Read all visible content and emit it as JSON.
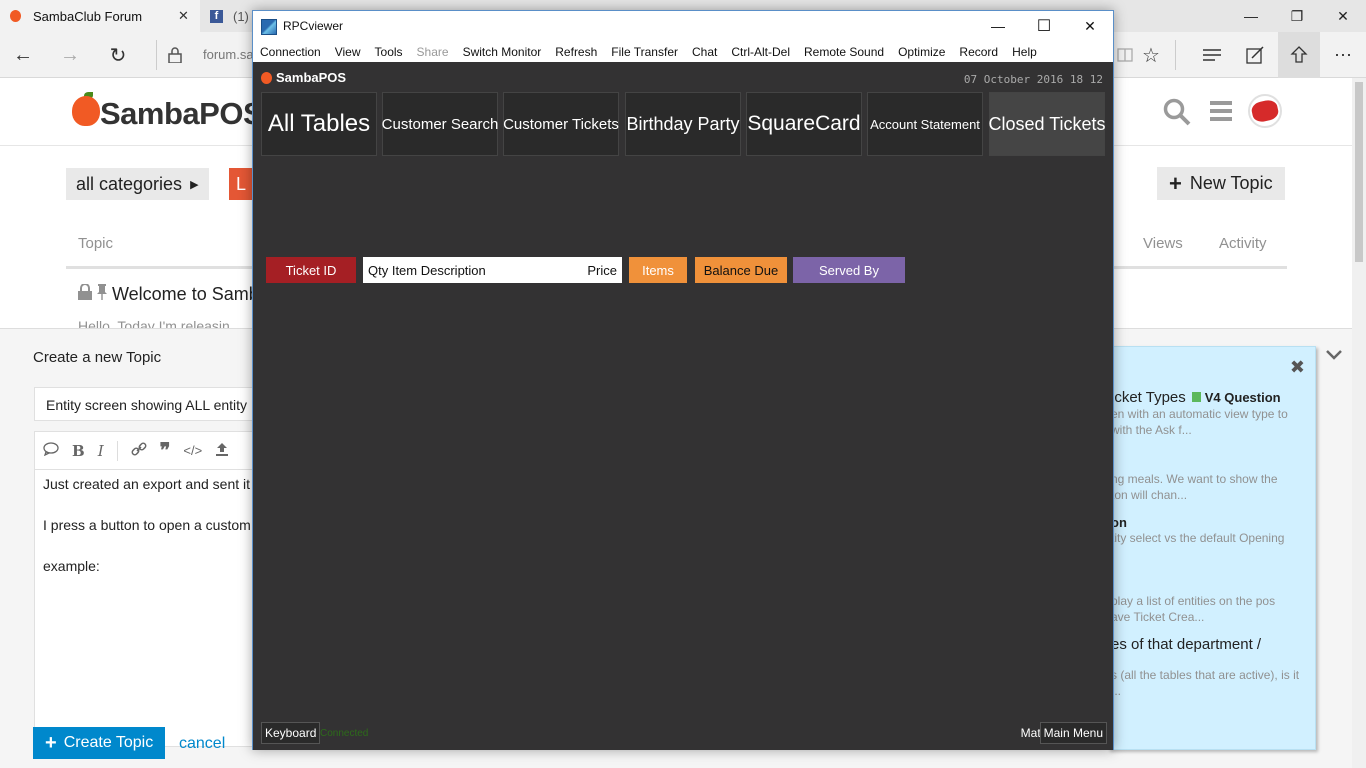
{
  "browser": {
    "tabs": [
      {
        "title": "SambaClub Forum",
        "close": "✕"
      },
      {
        "title": "(1)"
      }
    ],
    "address": "forum.sa",
    "window_controls": {
      "minimize": "—",
      "restore": "❐",
      "close": "✕"
    }
  },
  "forum": {
    "logo": "SambaPOS",
    "category_button": "all categories",
    "latest_button": "L",
    "new_topic_button": "New Topic",
    "columns": {
      "topic": "Topic",
      "views": "Views",
      "activity": "Activity"
    },
    "pinned_topic": {
      "title": "Welcome to Samb",
      "excerpt": "Hello. Today I'm releasin"
    },
    "composer": {
      "heading": "Create a new Topic",
      "title_value": "Entity screen showing ALL entity",
      "body_lines": [
        "Just created an export and sent it",
        "I press a button to open a custom",
        "example:"
      ],
      "create_button": "Create Topic",
      "cancel_link": "cancel"
    },
    "similar_topics": [
      {
        "title": "icket Types",
        "category": "V4 Question",
        "excerpt": [
          "en with an automatic view type to",
          "with the Ask f..."
        ]
      },
      {
        "title": "",
        "excerpt": [
          "ng meals. We want to show the",
          "ton will chan..."
        ]
      },
      {
        "title": "on",
        "excerpt": [
          "tity select vs the default Opening"
        ]
      },
      {
        "title": "",
        "excerpt": [
          "play a list of entities on the pos",
          "ave Ticket Crea..."
        ]
      },
      {
        "title": "es of that department /",
        "excerpt": [
          "s (all the tables that are active), is it",
          "..."
        ]
      }
    ]
  },
  "rpc": {
    "title": "RPCviewer",
    "menu": [
      "Connection",
      "View",
      "Tools",
      "Share",
      "Switch Monitor",
      "Refresh",
      "File Transfer",
      "Chat",
      "Ctrl-Alt-Del",
      "Remote Sound",
      "Optimize",
      "Record",
      "Help"
    ],
    "disabled_menu": "Share",
    "controls": {
      "minimize": "—",
      "maximize": "☐",
      "close": "✕"
    }
  },
  "sambapos": {
    "logo": "SambaPOS",
    "datetime": "07 October 2016 18 12",
    "entity_buttons": [
      "All Tables",
      "Customer Search",
      "Customer Tickets",
      "Birthday Party",
      "SquareCard",
      "Account Statement",
      "Closed Tickets"
    ],
    "header": {
      "ticket_id": "Ticket ID",
      "qty_item_description": "Qty Item Description",
      "price": "Price",
      "items": "Items",
      "balance_due": "Balance Due",
      "served_by": "Served By"
    },
    "colors": {
      "ticket_id": "#a51f24",
      "items": "#f0913a",
      "balance_due": "#f0913a",
      "served_by": "#7c64a8"
    },
    "bottom": {
      "keyboard": "Keyboard",
      "connected": "Connected",
      "user": "Matt",
      "main_menu": "Main Menu"
    }
  }
}
